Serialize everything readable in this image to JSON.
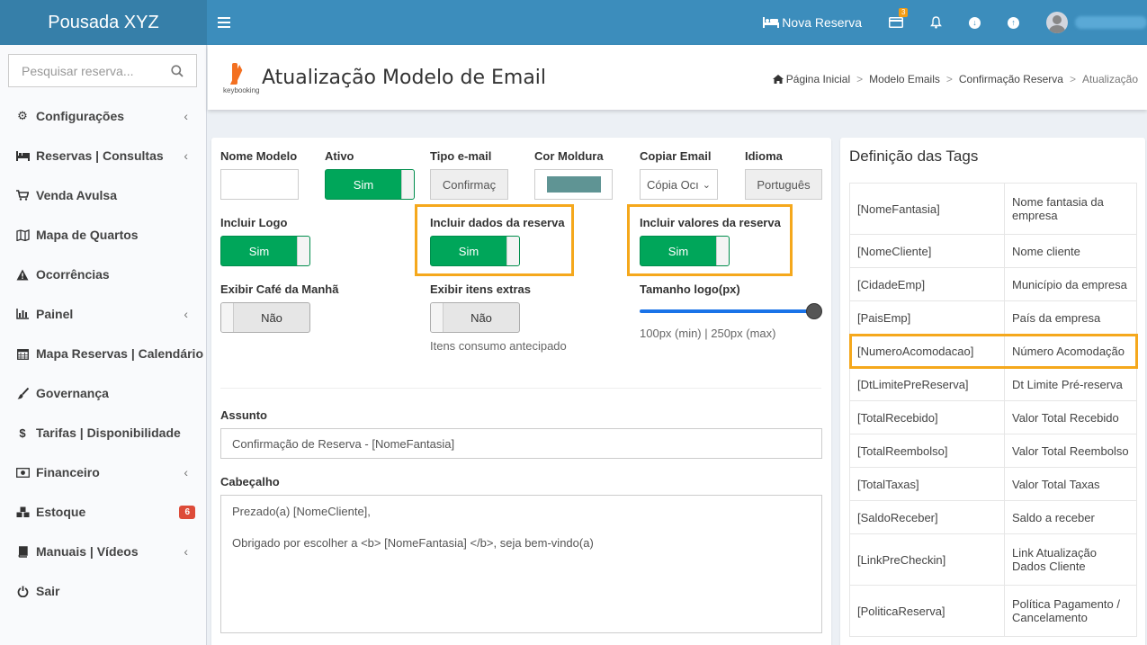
{
  "app": {
    "brand": "Pousada XYZ"
  },
  "topbar": {
    "new_reservation": "Nova Reserva",
    "notif_badge": "3",
    "username": ""
  },
  "sidebar": {
    "search_placeholder": "Pesquisar reserva...",
    "items": [
      {
        "label": "Configurações",
        "icon": "gears-icon",
        "chevron": "‹"
      },
      {
        "label": "Reservas | Consultas",
        "icon": "bed-icon",
        "chevron": "‹"
      },
      {
        "label": "Venda Avulsa",
        "icon": "cart-icon"
      },
      {
        "label": "Mapa de Quartos",
        "icon": "map-icon"
      },
      {
        "label": "Ocorrências",
        "icon": "warning-icon"
      },
      {
        "label": "Painel",
        "icon": "bar-chart-icon",
        "chevron": "‹"
      },
      {
        "label": "Mapa Reservas | Calendário",
        "icon": "calendar-icon"
      },
      {
        "label": "Governança",
        "icon": "brush-icon"
      },
      {
        "label": "Tarifas | Disponibilidade",
        "icon": "dollar-icon"
      },
      {
        "label": "Financeiro",
        "icon": "money-icon",
        "chevron": "‹"
      },
      {
        "label": "Estoque",
        "icon": "cubes-icon",
        "count": "6"
      },
      {
        "label": "Manuais | Vídeos",
        "icon": "book-icon",
        "chevron": "‹"
      },
      {
        "label": "Sair",
        "icon": "power-icon"
      }
    ]
  },
  "header": {
    "logo_text": "keybooking",
    "title": "Atualização Modelo de Email",
    "breadcrumb": [
      "Página Inicial",
      "Modelo Emails",
      "Confirmação Reserva",
      "Atualização"
    ]
  },
  "form": {
    "nome_modelo": {
      "label": "Nome Modelo",
      "value": ""
    },
    "ativo": {
      "label": "Ativo",
      "value": "Sim"
    },
    "tipo_email": {
      "label": "Tipo e-mail",
      "value": "Confirmaç"
    },
    "cor_moldura": {
      "label": "Cor Moldura",
      "color": "#5f9494"
    },
    "copiar_email": {
      "label": "Copiar Email",
      "value": "Cópia Ocı"
    },
    "idioma": {
      "label": "Idioma",
      "value": "Português"
    },
    "incluir_logo": {
      "label": "Incluir Logo",
      "value": "Sim"
    },
    "incluir_dados": {
      "label": "Incluir dados da reserva",
      "value": "Sim"
    },
    "incluir_valores": {
      "label": "Incluir valores da reserva",
      "value": "Sim"
    },
    "exibir_cafe": {
      "label": "Exibir Café da Manhã",
      "value": "Não"
    },
    "exibir_extras": {
      "label": "Exibir itens extras",
      "value": "Não",
      "help": "Itens consumo antecipado"
    },
    "tamanho_logo": {
      "label": "Tamanho logo(px)",
      "help": "100px (min) | 250px (max)",
      "value_fraction": 1.0
    },
    "assunto": {
      "label": "Assunto",
      "value": "Confirmação de Reserva - [NomeFantasia]"
    },
    "cabecalho": {
      "label": "Cabeçalho",
      "line1": "Prezado(a) [NomeCliente],",
      "line2": "Obrigado por escolher a <b> [NomeFantasia] </b>, seja bem-vindo(a)"
    }
  },
  "tags": {
    "title": "Definição das Tags",
    "rows": [
      {
        "tag": "[NomeFantasia]",
        "desc": "Nome fantasia da empresa"
      },
      {
        "tag": "[NomeCliente]",
        "desc": "Nome cliente"
      },
      {
        "tag": "[CidadeEmp]",
        "desc": "Município da empresa"
      },
      {
        "tag": "[PaisEmp]",
        "desc": "País da empresa"
      },
      {
        "tag": "[NumeroAcomodacao]",
        "desc": "Número Acomodação"
      },
      {
        "tag": "[DtLimitePreReserva]",
        "desc": "Dt Limite Pré-reserva"
      },
      {
        "tag": "[TotalRecebido]",
        "desc": "Valor Total Recebido"
      },
      {
        "tag": "[TotalReembolso]",
        "desc": "Valor Total Reembolso"
      },
      {
        "tag": "[TotalTaxas]",
        "desc": "Valor Total Taxas"
      },
      {
        "tag": "[SaldoReceber]",
        "desc": "Saldo a receber"
      },
      {
        "tag": "[LinkPreCheckin]",
        "desc": "Link Atualização Dados Cliente"
      },
      {
        "tag": "[PoliticaReserva]",
        "desc": "Política Pagamento / Cancelamento"
      }
    ]
  },
  "colors": {
    "primary": "#3c8dbc",
    "brand_bg": "#367fa9",
    "success": "#00a65a",
    "highlight": "#f5a81c",
    "danger": "#dd4b39"
  }
}
